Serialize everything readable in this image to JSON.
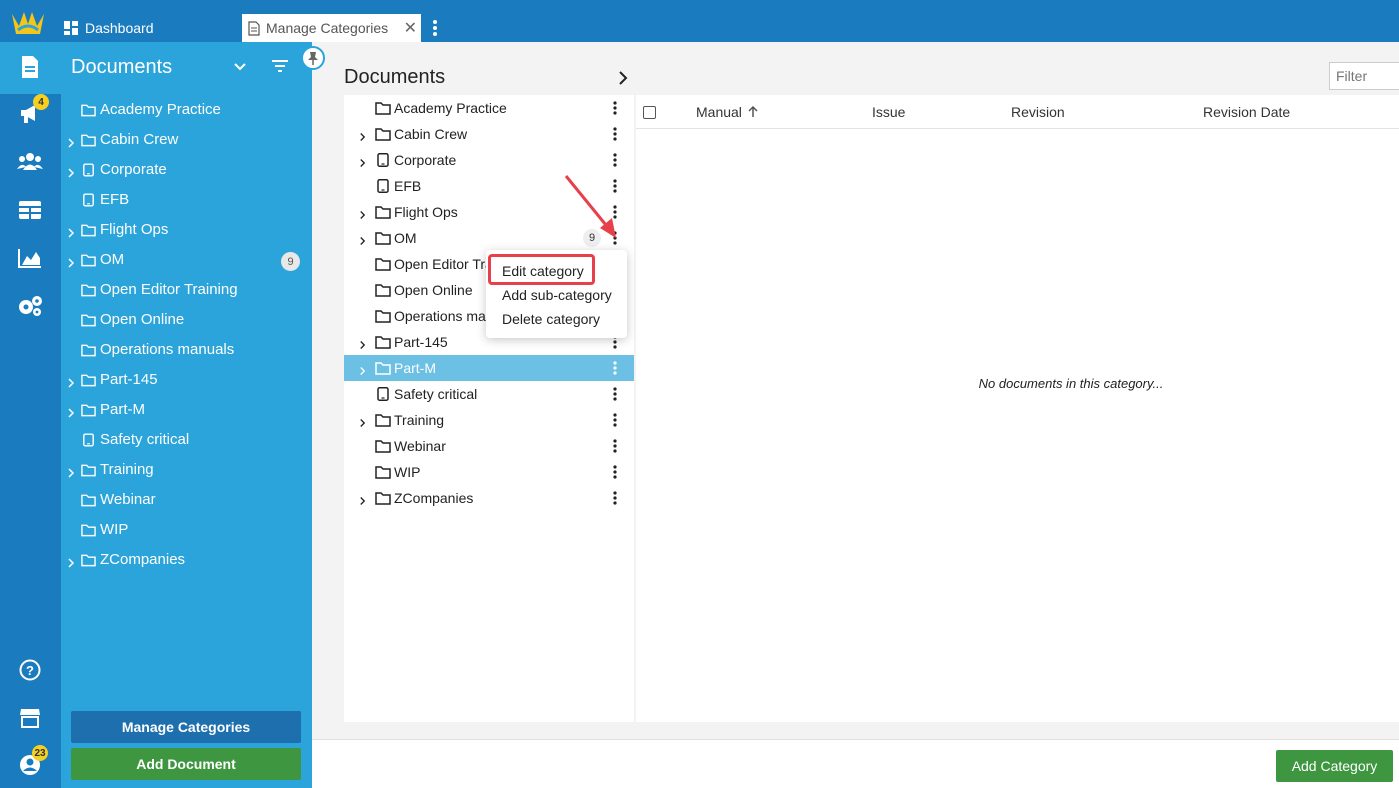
{
  "tabs": {
    "dashboard_label": "Dashboard",
    "active_label": "Manage Categories"
  },
  "rail": {
    "notifications_badge": "4",
    "profile_badge": "23"
  },
  "sidebar": {
    "title": "Documents",
    "items": [
      {
        "label": "Academy Practice",
        "icon": "folder-icon",
        "expandable": false
      },
      {
        "label": "Cabin Crew",
        "icon": "folder-icon",
        "expandable": true
      },
      {
        "label": "Corporate",
        "icon": "tablet-icon",
        "expandable": true
      },
      {
        "label": "EFB",
        "icon": "tablet-icon",
        "expandable": false
      },
      {
        "label": "Flight Ops",
        "icon": "folder-icon",
        "expandable": true
      },
      {
        "label": "OM",
        "icon": "folder-icon",
        "expandable": true,
        "count": "9"
      },
      {
        "label": "Open Editor Training",
        "icon": "folder-icon",
        "expandable": false
      },
      {
        "label": "Open Online",
        "icon": "folder-icon",
        "expandable": false
      },
      {
        "label": "Operations manuals",
        "icon": "folder-icon",
        "expandable": false
      },
      {
        "label": "Part-145",
        "icon": "folder-icon",
        "expandable": true
      },
      {
        "label": "Part-M",
        "icon": "folder-icon",
        "expandable": true
      },
      {
        "label": "Safety critical",
        "icon": "tablet-icon",
        "expandable": false
      },
      {
        "label": "Training",
        "icon": "folder-icon",
        "expandable": true
      },
      {
        "label": "Webinar",
        "icon": "folder-icon",
        "expandable": false
      },
      {
        "label": "WIP",
        "icon": "folder-icon",
        "expandable": false
      },
      {
        "label": "ZCompanies",
        "icon": "folder-icon",
        "expandable": true
      }
    ],
    "manage_button": "Manage Categories",
    "add_document_button": "Add Document"
  },
  "main": {
    "title": "Documents",
    "filter_placeholder": "Filter",
    "tree": [
      {
        "label": "Academy Practice",
        "icon": "folder-icon",
        "expandable": false
      },
      {
        "label": "Cabin Crew",
        "icon": "folder-icon",
        "expandable": true
      },
      {
        "label": "Corporate",
        "icon": "tablet-icon",
        "expandable": true
      },
      {
        "label": "EFB",
        "icon": "tablet-icon",
        "expandable": false
      },
      {
        "label": "Flight Ops",
        "icon": "folder-icon",
        "expandable": true
      },
      {
        "label": "OM",
        "icon": "folder-icon",
        "expandable": true,
        "count": "9"
      },
      {
        "label": "Open Editor Training",
        "icon": "folder-icon",
        "expandable": false
      },
      {
        "label": "Open Online",
        "icon": "folder-icon",
        "expandable": false
      },
      {
        "label": "Operations manuals",
        "icon": "folder-icon",
        "expandable": false
      },
      {
        "label": "Part-145",
        "icon": "folder-icon",
        "expandable": true
      },
      {
        "label": "Part-M",
        "icon": "folder-icon",
        "expandable": true,
        "selected": true
      },
      {
        "label": "Safety critical",
        "icon": "tablet-icon",
        "expandable": false
      },
      {
        "label": "Training",
        "icon": "folder-icon",
        "expandable": true
      },
      {
        "label": "Webinar",
        "icon": "folder-icon",
        "expandable": false
      },
      {
        "label": "WIP",
        "icon": "folder-icon",
        "expandable": false
      },
      {
        "label": "ZCompanies",
        "icon": "folder-icon",
        "expandable": true
      }
    ],
    "grid": {
      "columns": [
        "Manual",
        "Issue",
        "Revision",
        "Revision Date"
      ],
      "sort_column": "Manual",
      "empty_message": "No documents in this category..."
    },
    "add_category_button": "Add Category"
  },
  "context_menu": {
    "items": [
      "Edit category",
      "Add sub-category",
      "Delete category"
    ],
    "highlighted": "Edit category"
  },
  "colors": {
    "topbar": "#1a7bbf",
    "sidebar": "#2aa4da",
    "selected_row": "#6cc0e4",
    "green_button": "#3e9740",
    "highlight": "#e8404a"
  }
}
